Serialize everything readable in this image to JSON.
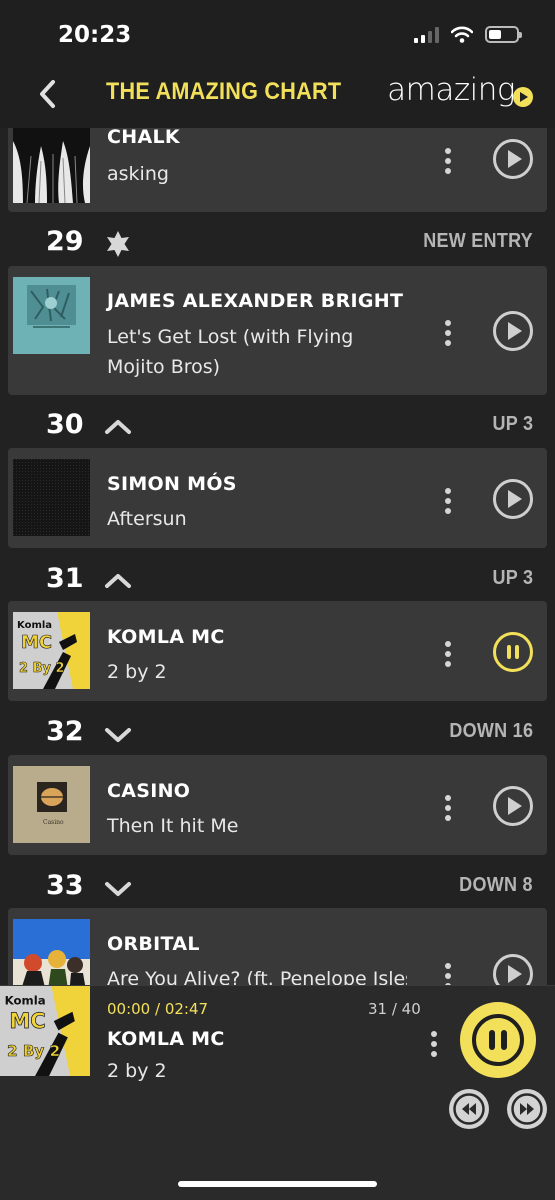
{
  "status_bar": {
    "time": "20:23"
  },
  "header": {
    "title": "THE AMAZING CHART",
    "logo_text": "amazing"
  },
  "colors": {
    "accent": "#f3e05a",
    "background": "#222222",
    "card": "#393939"
  },
  "chart_entries": [
    {
      "artist": "CHALK",
      "title": "asking",
      "state": "play"
    },
    {
      "rank": "29",
      "movement_icon": "star-icon",
      "movement": "NEW ENTRY",
      "artist": "JAMES ALEXANDER BRIGHT",
      "title": "Let's Get Lost (with Flying Mojito Bros)",
      "state": "play"
    },
    {
      "rank": "30",
      "movement_icon": "chevron-up-icon",
      "movement": "UP 3",
      "artist": "SIMON MÓS",
      "title": "Aftersun",
      "state": "play"
    },
    {
      "rank": "31",
      "movement_icon": "chevron-up-icon",
      "movement": "UP 3",
      "artist": "KOMLA MC",
      "title": "2 by 2",
      "state": "pause"
    },
    {
      "rank": "32",
      "movement_icon": "chevron-down-icon",
      "movement": "DOWN 16",
      "artist": "CASINO",
      "title": "Then It hit Me",
      "state": "play"
    },
    {
      "rank": "33",
      "movement_icon": "chevron-down-icon",
      "movement": "DOWN 8",
      "artist": "ORBITAL",
      "title": "Are You Alive? (ft. Penelope Isles)",
      "state": "play"
    }
  ],
  "player": {
    "elapsed": "00:00 / 02:47",
    "position": "31 / 40",
    "artist": "KOMLA MC",
    "title": "2 by 2",
    "cover_text_1": "Komla",
    "cover_text_2": "MC",
    "cover_text_3": "2 By 2"
  },
  "covers": {
    "komla_1": "Komla",
    "komla_2": "MC",
    "komla_3": "2 By 2",
    "casino": "Casino"
  }
}
